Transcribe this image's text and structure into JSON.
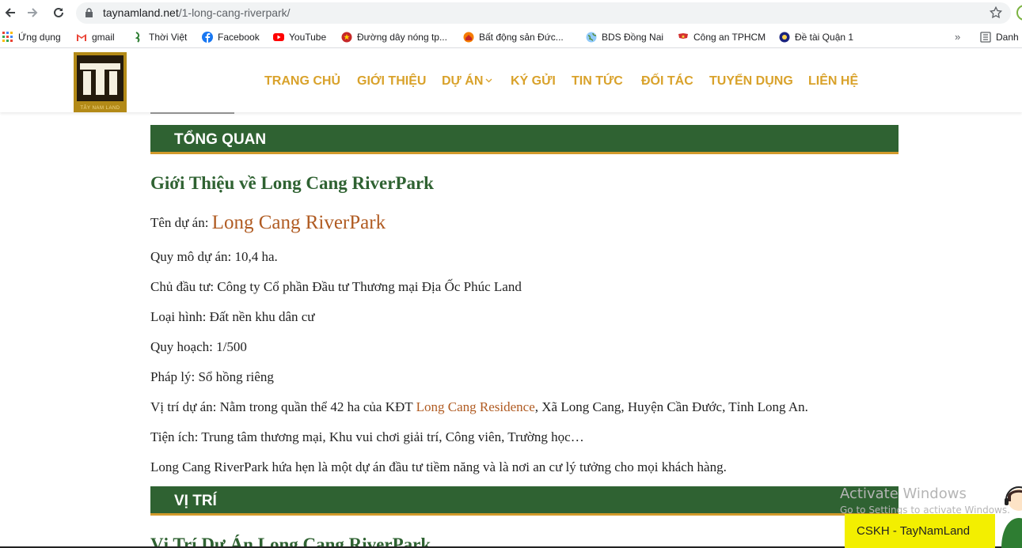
{
  "browser": {
    "url_host": "taynamland.net",
    "url_path": "/1-long-cang-riverpark/"
  },
  "bookmarks": [
    {
      "label": "Ứng dụng",
      "icon": "apps-grid-icon"
    },
    {
      "label": "gmail",
      "icon": "gmail-icon"
    },
    {
      "label": "Thời Việt",
      "icon": "thoiviet-icon"
    },
    {
      "label": "Facebook",
      "icon": "facebook-icon"
    },
    {
      "label": "YouTube",
      "icon": "youtube-icon"
    },
    {
      "label": "Đường dây nóng tp...",
      "icon": "emblem-icon"
    },
    {
      "label": "Bất động sản Đức...",
      "icon": "realestate-icon"
    },
    {
      "label": "BDS Đồng Nai",
      "icon": "globe-icon"
    },
    {
      "label": "Công an TPHCM",
      "icon": "flag-icon"
    },
    {
      "label": "Đề tài Quận 1",
      "icon": "round-logo-icon"
    }
  ],
  "bookmarks_more": "»",
  "bookmarks_folder": "Danh",
  "site": {
    "logo_text": "TÂY NAM LAND",
    "menu": [
      "TRANG CHỦ",
      "GIỚI THIỆU",
      "DỰ ÁN",
      "KÝ GỬI",
      "TIN TỨC",
      "ĐỐI TÁC",
      "TUYỂN DỤNG",
      "LIÊN HỆ"
    ]
  },
  "content": {
    "section1": "TỔNG QUAN",
    "heading1": "Giới Thiệu về Long Cang RiverPark",
    "project_label": "Tên dự án: ",
    "project_name": "Long Cang RiverPark",
    "scale": "Quy mô dự án: 10,4 ha.",
    "investor": "Chủ đầu tư: Công ty Cổ phần Đầu tư Thương mại Địa Ốc Phúc Land",
    "type": "Loại hình: Đất nền khu dân cư",
    "planning": "Quy hoạch: 1/500",
    "legal": "Pháp lý: Sổ hồng riêng",
    "location_prefix": "Vị trí dự án: Nằm trong quần thể 42 ha của KĐT ",
    "location_link": "Long Cang Residence",
    "location_suffix": ", Xã Long Cang, Huyện Cần Đước, Tỉnh Long An.",
    "amenities": "Tiện ích: Trung tâm thương mại, Khu vui chơi giải trí, Công viên, Trường học…",
    "promise": "Long Cang RiverPark hứa hẹn là một dự án đầu tư tiềm năng và là nơi an cư lý tưởng cho mọi khách hàng.",
    "section2": "VỊ TRÍ",
    "heading2": "Vị Trí Dự Án Long Cang RiverPark"
  },
  "overlay": {
    "activate_title": "Activate Windows",
    "activate_sub": "Go to Settings to activate Windows.",
    "cskh_label": "CSKH - TayNamLand"
  },
  "colors": {
    "accent_gold": "#d9a22b",
    "section_green": "#2f6232",
    "link_brown": "#b05b22"
  }
}
